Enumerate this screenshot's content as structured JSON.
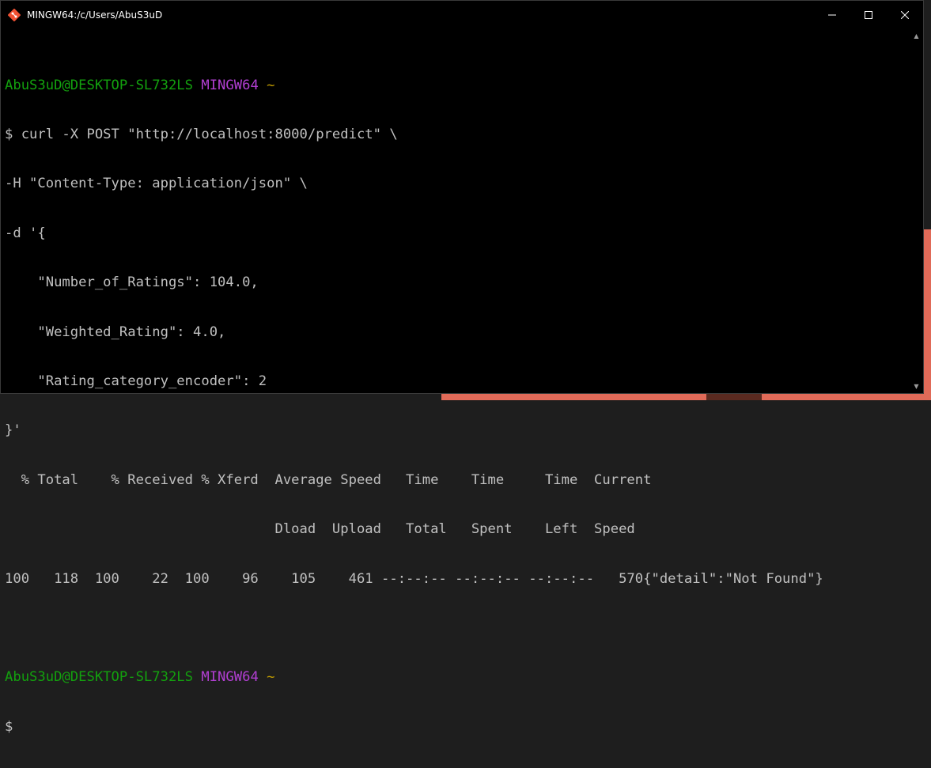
{
  "window": {
    "title": "MINGW64:/c/Users/AbuS3uD",
    "controls": {
      "minimize": "—",
      "maximize": "☐",
      "close": "✕"
    }
  },
  "terminal": {
    "prompt1": {
      "user_host": "AbuS3uD@DESKTOP-SL732LS",
      "shell": "MINGW64",
      "path": "~"
    },
    "lines": [
      "$ curl -X POST \"http://localhost:8000/predict\" \\",
      "-H \"Content-Type: application/json\" \\",
      "-d '{",
      "    \"Number_of_Ratings\": 104.0,",
      "    \"Weighted_Rating\": 4.0,",
      "    \"Rating_category_encoder\": 2",
      "}'",
      "  % Total    % Received % Xferd  Average Speed   Time    Time     Time  Current",
      "                                 Dload  Upload   Total   Spent    Left  Speed",
      "100   118  100    22  100    96    105    461 --:--:-- --:--:-- --:--:--   570{\"detail\":\"Not Found\"}"
    ],
    "prompt2": {
      "user_host": "AbuS3uD@DESKTOP-SL732LS",
      "shell": "MINGW64",
      "path": "~"
    },
    "cursor_line": "$"
  },
  "scrollbar": {
    "up": "▲",
    "down": "▼"
  },
  "colors": {
    "user": "#13a10e",
    "shell": "#b23fd3",
    "path": "#c19c00",
    "text": "#c0c0c0"
  }
}
